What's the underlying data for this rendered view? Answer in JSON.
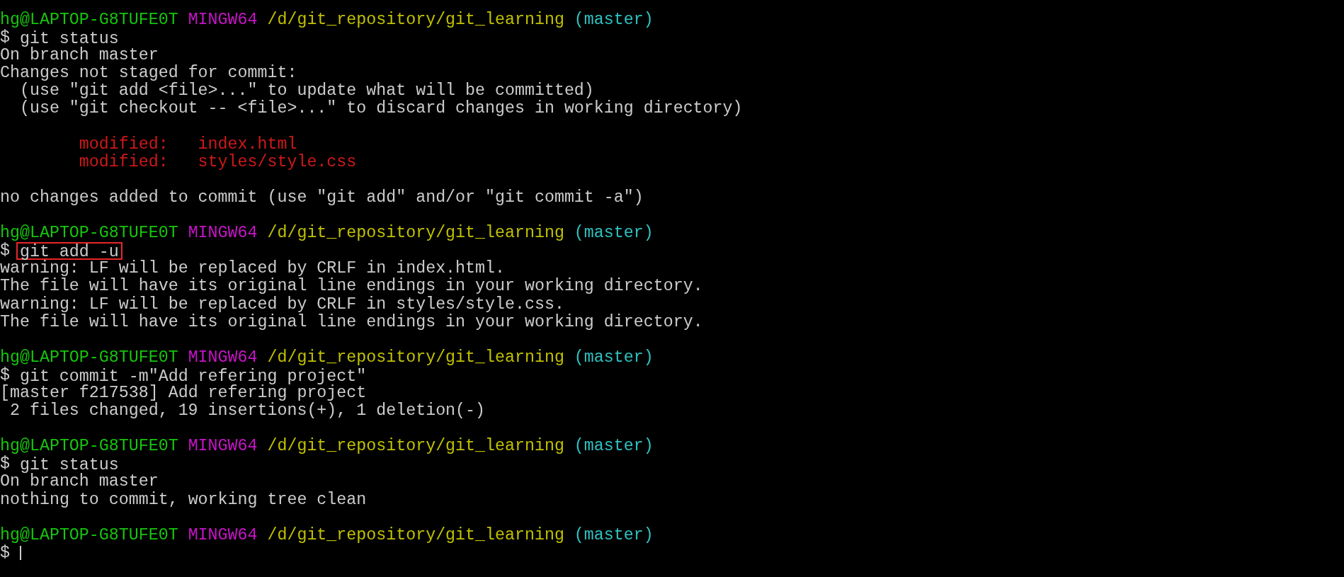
{
  "terminal": {
    "lines": [
      {
        "kind": "prompt",
        "user_host": "hg@LAPTOP-G8TUFE0T",
        "system": "MINGW64",
        "path": "/d/git_repository/git_learning",
        "branch": "(master)"
      },
      {
        "kind": "command",
        "symbol": "$",
        "text": "git status",
        "highlighted": false
      },
      {
        "kind": "output",
        "text": "On branch master"
      },
      {
        "kind": "output",
        "text": "Changes not staged for commit:"
      },
      {
        "kind": "hint",
        "text": "(use \"git add <file>...\" to update what will be committed)"
      },
      {
        "kind": "hint",
        "text": "(use \"git checkout -- <file>...\" to discard changes in working directory)"
      },
      {
        "kind": "blank"
      },
      {
        "kind": "modified",
        "label": "modified:",
        "file": "index.html"
      },
      {
        "kind": "modified",
        "label": "modified:",
        "file": "styles/style.css"
      },
      {
        "kind": "blank"
      },
      {
        "kind": "output",
        "text": "no changes added to commit (use \"git add\" and/or \"git commit -a\")"
      },
      {
        "kind": "blank"
      },
      {
        "kind": "prompt",
        "user_host": "hg@LAPTOP-G8TUFE0T",
        "system": "MINGW64",
        "path": "/d/git_repository/git_learning",
        "branch": "(master)"
      },
      {
        "kind": "command",
        "symbol": "$",
        "text": "git add -u",
        "highlighted": true
      },
      {
        "kind": "output",
        "text": "warning: LF will be replaced by CRLF in index.html."
      },
      {
        "kind": "output",
        "text": "The file will have its original line endings in your working directory."
      },
      {
        "kind": "output",
        "text": "warning: LF will be replaced by CRLF in styles/style.css."
      },
      {
        "kind": "output",
        "text": "The file will have its original line endings in your working directory."
      },
      {
        "kind": "blank"
      },
      {
        "kind": "prompt",
        "user_host": "hg@LAPTOP-G8TUFE0T",
        "system": "MINGW64",
        "path": "/d/git_repository/git_learning",
        "branch": "(master)"
      },
      {
        "kind": "command",
        "symbol": "$",
        "text": "git commit -m\"Add refering project\"",
        "highlighted": false
      },
      {
        "kind": "output",
        "text": "[master f217538] Add refering project"
      },
      {
        "kind": "summary",
        "text": "2 files changed, 19 insertions(+), 1 deletion(-)"
      },
      {
        "kind": "blank"
      },
      {
        "kind": "prompt",
        "user_host": "hg@LAPTOP-G8TUFE0T",
        "system": "MINGW64",
        "path": "/d/git_repository/git_learning",
        "branch": "(master)"
      },
      {
        "kind": "command",
        "symbol": "$",
        "text": "git status",
        "highlighted": false
      },
      {
        "kind": "output",
        "text": "On branch master"
      },
      {
        "kind": "output",
        "text": "nothing to commit, working tree clean"
      },
      {
        "kind": "blank"
      },
      {
        "kind": "prompt",
        "user_host": "hg@LAPTOP-G8TUFE0T",
        "system": "MINGW64",
        "path": "/d/git_repository/git_learning",
        "branch": "(master)"
      },
      {
        "kind": "input",
        "symbol": "$",
        "cursor": true
      }
    ]
  }
}
